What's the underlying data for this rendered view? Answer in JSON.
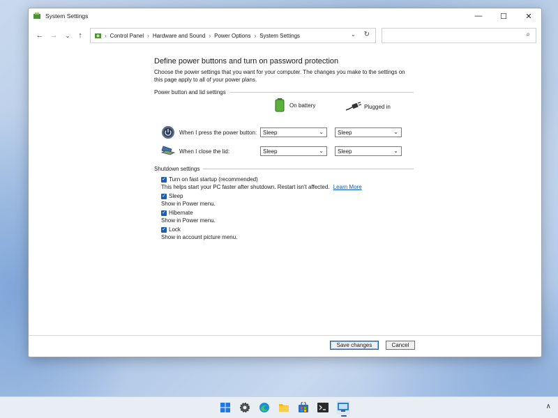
{
  "window": {
    "title": "System Settings",
    "controls": {
      "minimize": "—",
      "maximize": "☐",
      "close": "✕"
    }
  },
  "nav": {
    "back": "←",
    "forward": "→",
    "recent": "⌄",
    "up": "↑"
  },
  "address": {
    "separator": "›",
    "crumbs": [
      "Control Panel",
      "Hardware and Sound",
      "Power Options",
      "System Settings"
    ],
    "dropdown": "⌄",
    "refresh": "↻"
  },
  "search": {
    "placeholder": "",
    "icon": "⌕"
  },
  "page": {
    "heading": "Define power buttons and turn on password protection",
    "description": "Choose the power settings that you want for your computer. The changes you make to the settings on this page apply to all of your power plans.",
    "power_group_label": "Power button and lid settings",
    "col_battery": "On battery",
    "col_plugged": "Plugged in",
    "rows": [
      {
        "label": "When I press the power button:",
        "battery": "Sleep",
        "plugged": "Sleep"
      },
      {
        "label": "When I close the lid:",
        "battery": "Sleep",
        "plugged": "Sleep"
      }
    ],
    "shutdown_group_label": "Shutdown settings",
    "shutdown_items": [
      {
        "label": "Turn on fast startup (recommended)",
        "sub": "This helps start your PC faster after shutdown. Restart isn't affected.",
        "link": "Learn More",
        "checked": true
      },
      {
        "label": "Sleep",
        "sub": "Show in Power menu.",
        "checked": true
      },
      {
        "label": "Hibernate",
        "sub": "Show in Power menu.",
        "checked": true
      },
      {
        "label": "Lock",
        "sub": "Show in account picture menu.",
        "checked": true
      }
    ]
  },
  "footer": {
    "save": "Save changes",
    "cancel": "Cancel"
  },
  "taskbar": {
    "icons": [
      "windows-start-icon",
      "settings-gear-icon",
      "edge-browser-icon",
      "file-explorer-icon",
      "store-icon",
      "terminal-icon",
      "control-panel-icon"
    ],
    "tray_chevron": "∧"
  },
  "colors": {
    "accent": "#1f5fa8",
    "link": "#0b57b5"
  }
}
